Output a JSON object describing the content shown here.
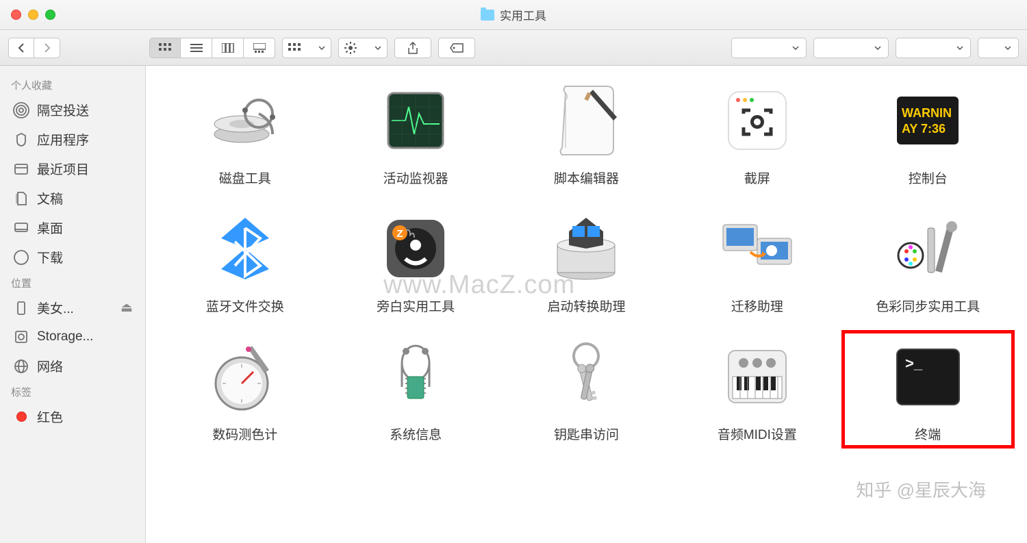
{
  "window": {
    "title": "实用工具"
  },
  "sidebar": {
    "sections": [
      {
        "header": "个人收藏",
        "items": [
          {
            "icon": "airdrop",
            "label": "隔空投送"
          },
          {
            "icon": "apps",
            "label": "应用程序"
          },
          {
            "icon": "recent",
            "label": "最近项目"
          },
          {
            "icon": "docs",
            "label": "文稿"
          },
          {
            "icon": "desktop",
            "label": "桌面"
          },
          {
            "icon": "download",
            "label": "下载"
          }
        ]
      },
      {
        "header": "位置",
        "items": [
          {
            "icon": "phone",
            "label": "美女...",
            "eject": true
          },
          {
            "icon": "disk",
            "label": "Storage..."
          },
          {
            "icon": "globe",
            "label": "网络"
          }
        ]
      },
      {
        "header": "标签",
        "items": [
          {
            "icon": "tag-red",
            "label": "红色"
          }
        ]
      }
    ]
  },
  "apps": [
    {
      "icon": "disk-utility",
      "label": "磁盘工具"
    },
    {
      "icon": "activity",
      "label": "活动监视器"
    },
    {
      "icon": "script",
      "label": "脚本编辑器"
    },
    {
      "icon": "screenshot",
      "label": "截屏"
    },
    {
      "icon": "console",
      "label": "控制台",
      "console_text1": "WARNIN",
      "console_text2": "AY 7:36"
    },
    {
      "icon": "bluetooth",
      "label": "蓝牙文件交换"
    },
    {
      "icon": "voiceover",
      "label": "旁白实用工具"
    },
    {
      "icon": "bootcamp",
      "label": "启动转换助理"
    },
    {
      "icon": "migration",
      "label": "迁移助理"
    },
    {
      "icon": "colorsync",
      "label": "色彩同步实用工具"
    },
    {
      "icon": "colormeter",
      "label": "数码测色计"
    },
    {
      "icon": "sysinfo",
      "label": "系统信息"
    },
    {
      "icon": "keychain",
      "label": "钥匙串访问"
    },
    {
      "icon": "midi",
      "label": "音频MIDI设置"
    },
    {
      "icon": "terminal",
      "label": "终端",
      "highlight": true
    }
  ],
  "watermark": "www.MacZ.com",
  "watermark2": "知乎 @星辰大海"
}
